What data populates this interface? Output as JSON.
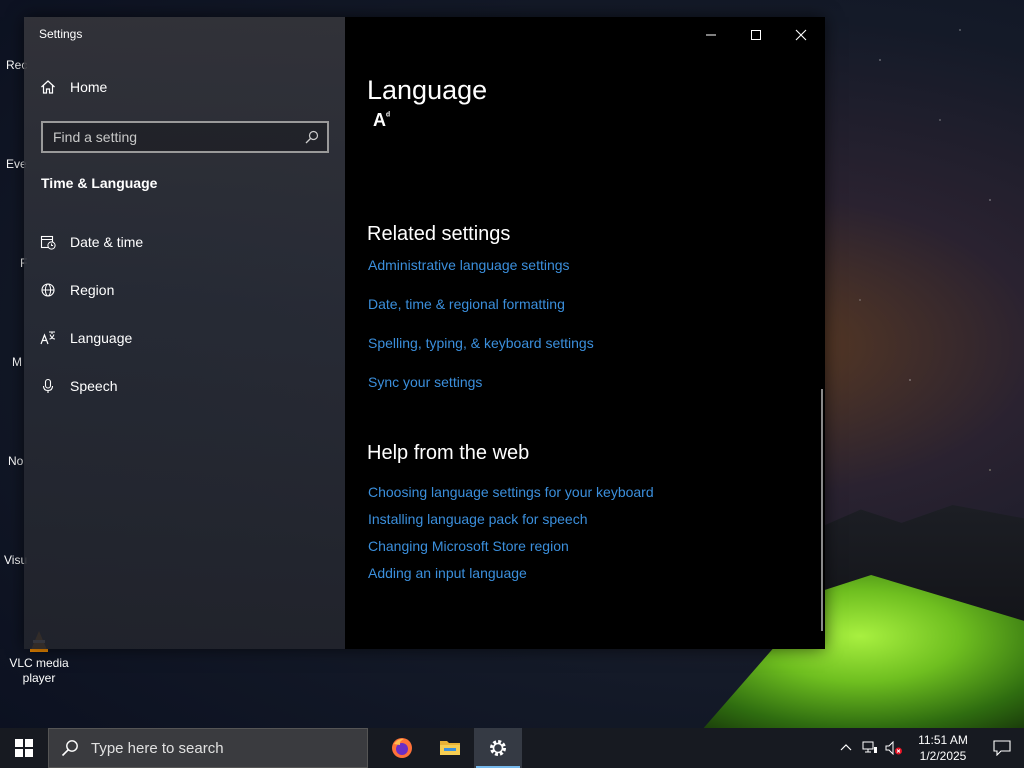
{
  "desktop": {
    "icons": [
      {
        "label": "Rec"
      },
      {
        "label": "Eve"
      },
      {
        "label": "F"
      },
      {
        "label": "M"
      },
      {
        "label": "No"
      },
      {
        "label": "Visu"
      },
      {
        "label": "VLC media player"
      }
    ]
  },
  "window": {
    "title": "Settings",
    "sidebar": {
      "home_label": "Home",
      "search_placeholder": "Find a setting",
      "section_label": "Time & Language",
      "items": [
        {
          "label": "Date & time",
          "icon": "date-time-icon"
        },
        {
          "label": "Region",
          "icon": "globe-icon"
        },
        {
          "label": "Language",
          "icon": "language-icon"
        },
        {
          "label": "Speech",
          "icon": "microphone-icon"
        }
      ]
    },
    "content": {
      "title": "Language",
      "glyph": "A",
      "glyph_sup": "ᵈ",
      "related_heading": "Related settings",
      "related_links": [
        "Administrative language settings",
        "Date, time & regional formatting",
        "Spelling, typing, & keyboard settings",
        "Sync your settings"
      ],
      "help_heading": "Help from the web",
      "help_links": [
        "Choosing language settings for your keyboard",
        "Installing language pack for speech",
        "Changing Microsoft Store region",
        "Adding an input language"
      ]
    },
    "link_color": "#3b8fdc"
  },
  "taskbar": {
    "search_placeholder": "Type here to search",
    "apps": [
      "firefox-icon",
      "file-explorer-icon",
      "settings-gear-icon"
    ],
    "clock_time": "11:51 AM",
    "clock_date": "1/2/2025"
  }
}
